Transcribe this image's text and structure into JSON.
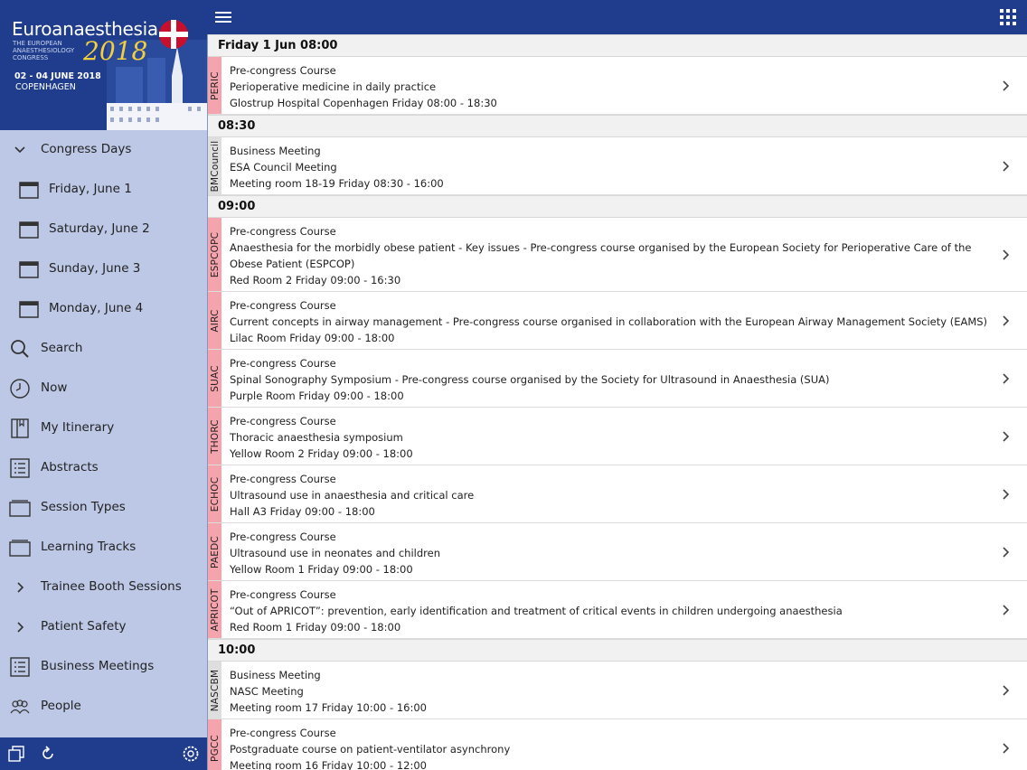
{
  "banner": {
    "title": "Euroanaesthesia",
    "subtitle": "THE EUROPEAN ANAESTHESIOLOGY CONGRESS",
    "year": "2018",
    "dates": "02 - 04 JUNE 2018",
    "city": "COPENHAGEN"
  },
  "sidebar": {
    "items": [
      {
        "label": "Congress Days",
        "icon": "chevron-down-icon"
      },
      {
        "label": "Friday, June 1",
        "icon": "calendar-icon"
      },
      {
        "label": "Saturday, June 2",
        "icon": "calendar-icon"
      },
      {
        "label": "Sunday, June 3",
        "icon": "calendar-icon"
      },
      {
        "label": "Monday, June 4",
        "icon": "calendar-icon"
      },
      {
        "label": "Search",
        "icon": "search-icon"
      },
      {
        "label": "Now",
        "icon": "clock-icon"
      },
      {
        "label": "My Itinerary",
        "icon": "book-icon"
      },
      {
        "label": "Abstracts",
        "icon": "list-icon"
      },
      {
        "label": "Session Types",
        "icon": "folder-icon"
      },
      {
        "label": "Learning Tracks",
        "icon": "folder-icon"
      },
      {
        "label": "Trainee Booth Sessions",
        "icon": "chevron-right-icon"
      },
      {
        "label": "Patient Safety",
        "icon": "chevron-right-icon"
      },
      {
        "label": "Business Meetings",
        "icon": "list-icon"
      },
      {
        "label": "People",
        "icon": "people-icon"
      }
    ]
  },
  "colors": {
    "brand": "#1f3d8c",
    "sidebar_bg": "#bcc8e6",
    "precongress_tag": "#f5a3ad",
    "meeting_tag": "#dedede"
  },
  "list": {
    "groups": [
      {
        "time": "Friday 1 Jun 08:00",
        "sessions": [
          {
            "code": "PERIC",
            "type": "Pre-congress Course",
            "title": "Perioperative medicine in daily practice",
            "location": "Glostrup Hospital Copenhagen Friday 08:00 - 18:30",
            "kind": "course"
          }
        ]
      },
      {
        "time": "08:30",
        "sessions": [
          {
            "code": "BMCouncil",
            "type": "Business Meeting",
            "title": "ESA Council Meeting",
            "location": "Meeting room 18-19 Friday 08:30 - 16:00",
            "kind": "meeting"
          }
        ]
      },
      {
        "time": "09:00",
        "sessions": [
          {
            "code": "ESPCOPC",
            "type": "Pre-congress Course",
            "title": "Anaesthesia for the morbidly obese patient - Key issues - Pre-congress course organised by the European Society for Perioperative Care of the Obese Patient (ESPCOP)",
            "location": "Red Room 2 Friday 09:00 - 16:30",
            "kind": "course"
          },
          {
            "code": "AIRC",
            "type": "Pre-congress Course",
            "title": "Current concepts in airway management - Pre-congress course organised in collaboration with the European Airway Management Society (EAMS)",
            "location": "Lilac Room Friday 09:00 - 18:00",
            "kind": "course"
          },
          {
            "code": "SUAC",
            "type": "Pre-congress Course",
            "title": "Spinal Sonography Symposium - Pre-congress course organised by the Society for Ultrasound in Anaesthesia (SUA)",
            "location": "Purple Room Friday 09:00 - 18:00",
            "kind": "course"
          },
          {
            "code": "THORC",
            "type": "Pre-congress Course",
            "title": "Thoracic anaesthesia symposium",
            "location": "Yellow Room 2 Friday 09:00 - 18:00",
            "kind": "course"
          },
          {
            "code": "ECHOC",
            "type": "Pre-congress Course",
            "title": "Ultrasound use in anaesthesia and critical care",
            "location": "Hall A3 Friday 09:00 - 18:00",
            "kind": "course"
          },
          {
            "code": "PAEDC",
            "type": "Pre-congress Course",
            "title": "Ultrasound use in neonates and children",
            "location": "Yellow Room 1 Friday 09:00 - 18:00",
            "kind": "course"
          },
          {
            "code": "APRICOT",
            "type": "Pre-congress Course",
            "title": "“Out of APRICOT”: prevention, early identification and treatment of critical events in children undergoing anaesthesia",
            "location": "Red Room 1 Friday 09:00 - 18:00",
            "kind": "course"
          }
        ]
      },
      {
        "time": "10:00",
        "sessions": [
          {
            "code": "NASCBM",
            "type": "Business Meeting",
            "title": "NASC Meeting",
            "location": "Meeting room 17 Friday 10:00 - 16:00",
            "kind": "meeting"
          },
          {
            "code": "PGCC",
            "type": "Pre-congress Course",
            "title": "Postgraduate course on patient-ventilator asynchrony",
            "location": "Meeting room 16 Friday 10:00 - 12:00",
            "kind": "course"
          }
        ]
      }
    ]
  }
}
